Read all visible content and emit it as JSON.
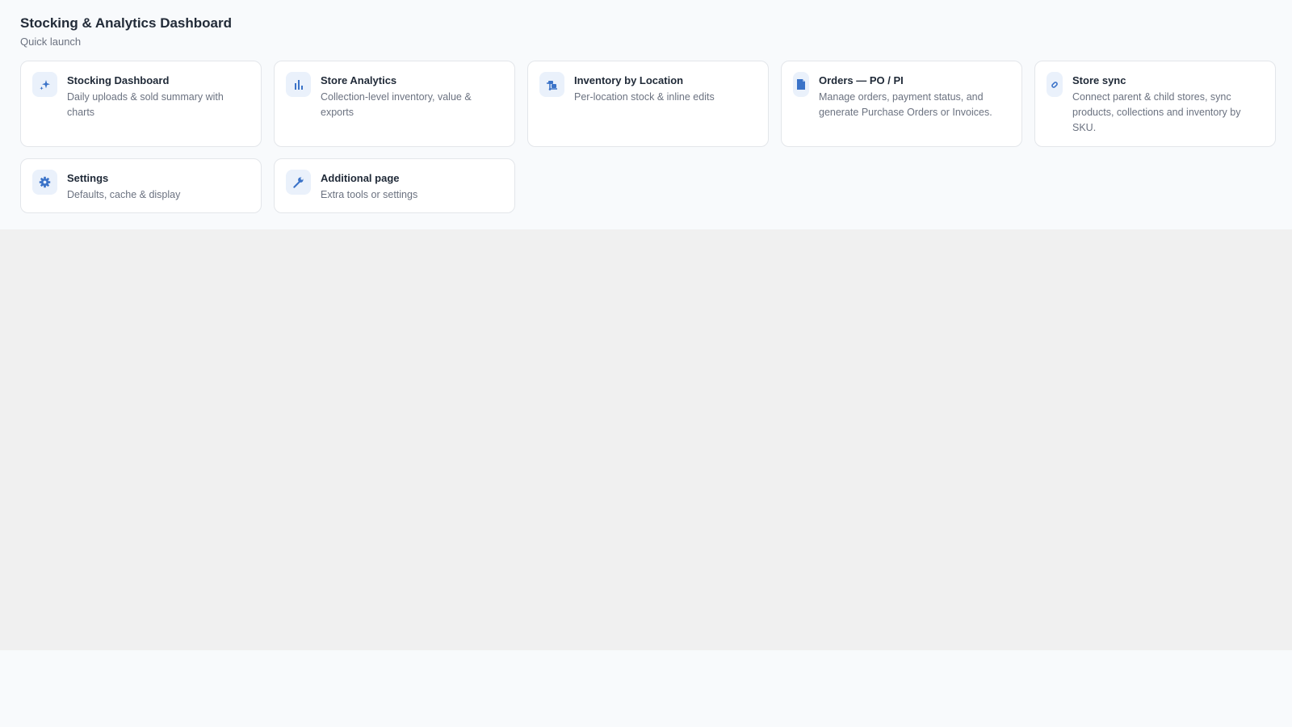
{
  "header": {
    "title": "Stocking & Analytics Dashboard",
    "subtitle": "Quick launch"
  },
  "cards": [
    {
      "title": "Stocking Dashboard",
      "description": "Daily uploads & sold summary with charts",
      "icon": "sparkles-icon"
    },
    {
      "title": "Store Analytics",
      "description": "Collection-level inventory, value & exports",
      "icon": "bar-chart-icon"
    },
    {
      "title": "Inventory by Location",
      "description": "Per-location stock & inline edits",
      "icon": "dolly-icon"
    },
    {
      "title": "Orders — PO / PI",
      "description": "Manage orders, payment status, and generate Purchase Orders or Invoices.",
      "icon": "document-icon"
    },
    {
      "title": "Store sync",
      "description": "Connect parent & child stores, sync products, collections and inventory by SKU.",
      "icon": "link-icon"
    },
    {
      "title": "Settings",
      "description": "Defaults, cache & display",
      "icon": "gear-icon"
    },
    {
      "title": "Additional page",
      "description": "Extra tools or settings",
      "icon": "wrench-icon"
    }
  ],
  "colors": {
    "accent": "#3b73c8",
    "icon_tile_bg": "#eaf1fb",
    "page_bg": "#f8fafc",
    "content_bg": "#f0f0f0"
  }
}
